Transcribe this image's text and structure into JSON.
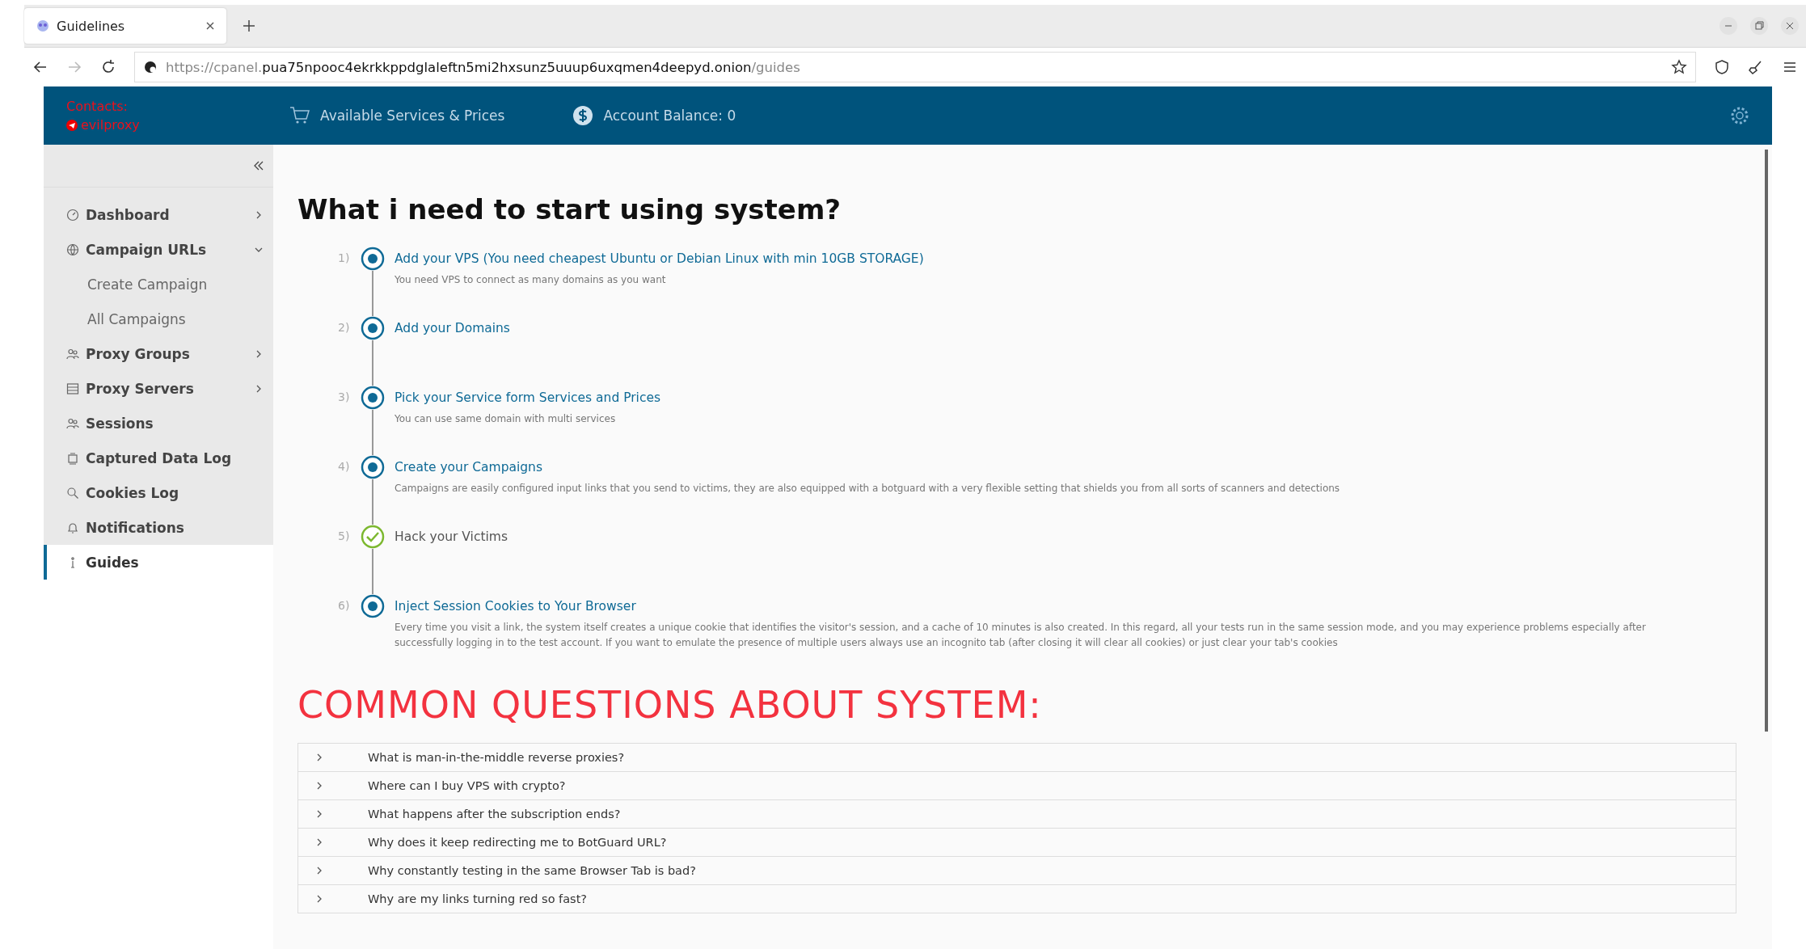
{
  "browser": {
    "tab": {
      "title": "Guidelines",
      "selected": true
    },
    "url": {
      "prefix": "https://cpanel.",
      "host": "pua75npooc4ekrkkppdglaleftn5mi2hxsunz5uuup6uxqmen4deepyd.onion",
      "path": "/guides"
    }
  },
  "header": {
    "contacts_label": "Contacts:",
    "contact": "evilproxy",
    "services": "Available Services & Prices",
    "balance": "Account Balance: 0"
  },
  "sidebar": {
    "items": [
      {
        "label": "Dashboard",
        "kind": "submenu",
        "selected": false
      },
      {
        "label": "Campaign URLs",
        "kind": "group",
        "expanded": true,
        "selected": false,
        "children": [
          {
            "label": "Create Campaign",
            "selected": false
          },
          {
            "label": "All Campaigns",
            "selected": false
          }
        ]
      },
      {
        "label": "Proxy Groups",
        "kind": "submenu",
        "selected": false
      },
      {
        "label": "Proxy Servers",
        "kind": "submenu",
        "selected": false
      },
      {
        "label": "Sessions",
        "kind": "plain",
        "selected": false
      },
      {
        "label": "Captured Data Log",
        "kind": "plain",
        "selected": false
      },
      {
        "label": "Cookies Log",
        "kind": "plain",
        "selected": false
      },
      {
        "label": "Notifications",
        "kind": "plain",
        "selected": false
      },
      {
        "label": "Guides",
        "kind": "plain",
        "selected": true
      }
    ]
  },
  "main": {
    "title": "What i need to start using system?",
    "steps": [
      {
        "number": "1)",
        "kind": "dot",
        "title": "Add your VPS (You need cheapest Ubuntu or Debian Linux with min 10GB STORAGE)",
        "description": "You need VPS to connect as many domains as you want"
      },
      {
        "number": "2)",
        "kind": "dot",
        "title": "Add your Domains"
      },
      {
        "number": "3)",
        "kind": "dot",
        "title": "Pick your Service form Services and Prices",
        "description": "You can use same domain with multi services"
      },
      {
        "number": "4)",
        "kind": "dot",
        "title": "Create your Campaigns",
        "description": "Campaigns are easily configured input links that you send to victims, they are also equipped with a botguard with a very flexible setting that shields you from all sorts of scanners and detections"
      },
      {
        "number": "5)",
        "kind": "check",
        "title": "Hack your Victims"
      },
      {
        "number": "6)",
        "kind": "dot",
        "title": "Inject Session Cookies to Your Browser",
        "description": "Every time you visit a link, the system itself creates a unique cookie that identifies the visitor's session, and a cache of 10 minutes is also created. In this regard, all your tests run in the same session mode, and you may experience problems especially after successfully logging in to the test account. If you want to emulate the presence of multiple users always use an incognito tab (after closing it will clear all cookies) or just clear your tab's cookies"
      }
    ],
    "faq_title": "COMMON QUESTIONS ABOUT SYSTEM:",
    "faq": [
      {
        "question": "What is man-in-the-middle reverse proxies?",
        "expanded": false
      },
      {
        "question": "Where can I buy VPS with crypto?",
        "expanded": false
      },
      {
        "question": "What happens after the subscription ends?",
        "expanded": false
      },
      {
        "question": "Why does it keep redirecting me to BotGuard URL?",
        "expanded": false
      },
      {
        "question": "Why constantly testing in the same Browser Tab is bad?",
        "expanded": false
      },
      {
        "question": "Why are my links turning red so fast?",
        "expanded": false
      }
    ]
  }
}
